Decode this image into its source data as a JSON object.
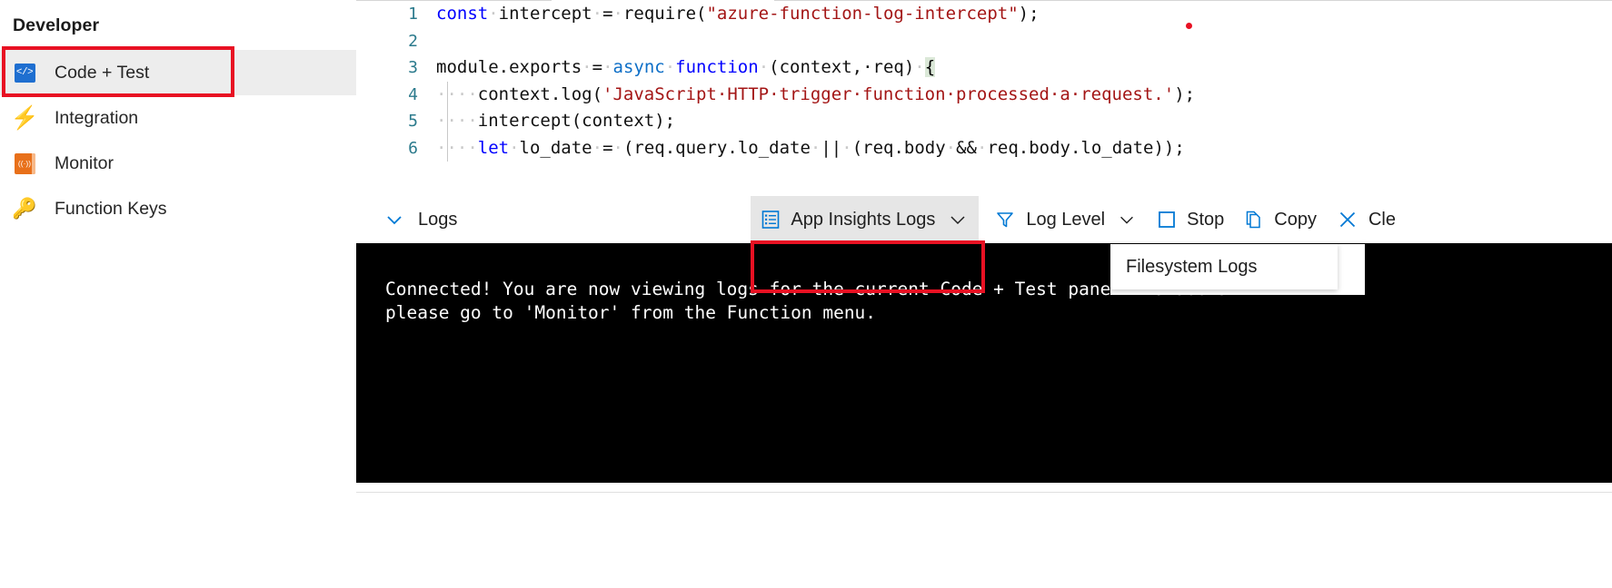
{
  "sidebar": {
    "heading": "Developer",
    "items": [
      {
        "label": "Code + Test",
        "icon": "code-icon",
        "selected": true
      },
      {
        "label": "Integration",
        "icon": "lightning-bolt-icon",
        "selected": false
      },
      {
        "label": "Monitor",
        "icon": "monitor-book-icon",
        "selected": false
      },
      {
        "label": "Function Keys",
        "icon": "key-icon",
        "selected": false
      }
    ]
  },
  "editor": {
    "lines": [
      {
        "number": "1",
        "tokens": [
          {
            "t": "const",
            "c": "kw-blue"
          },
          {
            "t": "·",
            "c": "ws"
          },
          {
            "t": "intercept",
            "c": "plain"
          },
          {
            "t": "·",
            "c": "ws"
          },
          {
            "t": "=",
            "c": "plain"
          },
          {
            "t": "·",
            "c": "ws"
          },
          {
            "t": "require(",
            "c": "plain"
          },
          {
            "t": "\"azure-function-log-intercept\"",
            "c": "str-red"
          },
          {
            "t": ");",
            "c": "plain"
          }
        ]
      },
      {
        "number": "2",
        "tokens": []
      },
      {
        "number": "3",
        "tokens": [
          {
            "t": "module.exports",
            "c": "plain"
          },
          {
            "t": "·",
            "c": "ws"
          },
          {
            "t": "=",
            "c": "plain"
          },
          {
            "t": "·",
            "c": "ws"
          },
          {
            "t": "async",
            "c": "kw-cyan"
          },
          {
            "t": "·",
            "c": "ws"
          },
          {
            "t": "function",
            "c": "kw-blue"
          },
          {
            "t": "·",
            "c": "ws"
          },
          {
            "t": "(context,·req)",
            "c": "plain"
          },
          {
            "t": "·",
            "c": "ws"
          },
          {
            "t": "{",
            "c": "brkt-hl"
          }
        ]
      },
      {
        "number": "4",
        "tokens": [
          {
            "t": "····",
            "c": "ws"
          },
          {
            "t": "context.log(",
            "c": "plain"
          },
          {
            "t": "'JavaScript·HTTP·trigger·function·processed·a·request.'",
            "c": "str-red"
          },
          {
            "t": ");",
            "c": "plain"
          }
        ]
      },
      {
        "number": "5",
        "tokens": [
          {
            "t": "····",
            "c": "ws"
          },
          {
            "t": "intercept(context);",
            "c": "plain"
          }
        ]
      },
      {
        "number": "6",
        "tokens": [
          {
            "t": "····",
            "c": "ws"
          },
          {
            "t": "let",
            "c": "kw-blue"
          },
          {
            "t": "·",
            "c": "ws"
          },
          {
            "t": "lo_date",
            "c": "plain"
          },
          {
            "t": "·",
            "c": "ws"
          },
          {
            "t": "=",
            "c": "plain"
          },
          {
            "t": "·",
            "c": "ws"
          },
          {
            "t": "(req.query.lo_date",
            "c": "plain"
          },
          {
            "t": "·",
            "c": "ws"
          },
          {
            "t": "||",
            "c": "plain"
          },
          {
            "t": "·",
            "c": "ws"
          },
          {
            "t": "(req.body",
            "c": "plain"
          },
          {
            "t": "·",
            "c": "ws"
          },
          {
            "t": "&&",
            "c": "plain"
          },
          {
            "t": "·",
            "c": "ws"
          },
          {
            "t": "req.body.lo_date));",
            "c": "plain"
          }
        ]
      }
    ]
  },
  "toolbar": {
    "logs_label": "Logs",
    "app_insights_label": "App Insights Logs",
    "log_level_label": "Log Level",
    "stop_label": "Stop",
    "copy_label": "Copy",
    "clear_label": "Cle"
  },
  "dropdown": {
    "items": [
      {
        "label": "Filesystem Logs"
      }
    ]
  },
  "console": {
    "text": "Connected! You are now viewing logs for the current Code + Test panel. To see all\nplease go to 'Monitor' from the Function menu."
  },
  "colors": {
    "accent_blue": "#0078d4",
    "annotation_red": "#e81123",
    "selected_bg": "#ededed",
    "console_bg": "#000000"
  }
}
